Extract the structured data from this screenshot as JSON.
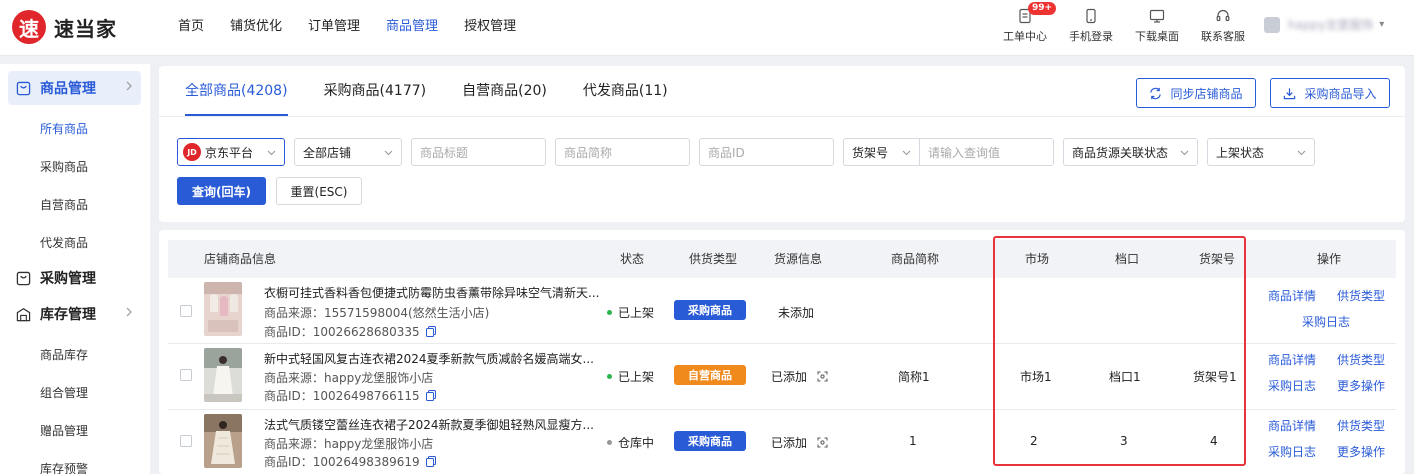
{
  "app": {
    "logo_char": "速",
    "name": "速当家"
  },
  "top_nav": [
    {
      "label": "首页"
    },
    {
      "label": "铺货优化"
    },
    {
      "label": "订单管理"
    },
    {
      "label": "商品管理",
      "active": true
    },
    {
      "label": "授权管理"
    }
  ],
  "tools": [
    {
      "label": "工单中心",
      "icon": "ticket-icon",
      "badge": "99+"
    },
    {
      "label": "手机登录",
      "icon": "mobile-icon"
    },
    {
      "label": "下载桌面",
      "icon": "desktop-icon"
    },
    {
      "label": "联系客服",
      "icon": "headset-icon"
    }
  ],
  "user": {
    "name": "happy龙堡服饰"
  },
  "sidebar": {
    "groups": [
      {
        "label": "商品管理",
        "icon": "product-icon",
        "active": true,
        "items": [
          {
            "label": "所有商品",
            "active": true
          },
          {
            "label": "采购商品"
          },
          {
            "label": "自营商品"
          },
          {
            "label": "代发商品"
          }
        ]
      },
      {
        "label": "采购管理",
        "icon": "purchase-icon"
      },
      {
        "label": "库存管理",
        "icon": "warehouse-icon",
        "items": [
          {
            "label": "商品库存"
          },
          {
            "label": "组合管理"
          },
          {
            "label": "赠品管理"
          },
          {
            "label": "库存预警"
          }
        ]
      }
    ]
  },
  "tabs": [
    {
      "label": "全部商品(4208)",
      "active": true
    },
    {
      "label": "采购商品(4177)"
    },
    {
      "label": "自营商品(20)"
    },
    {
      "label": "代发商品(11)"
    }
  ],
  "actions": {
    "sync_label": "同步店铺商品",
    "import_label": "采购商品导入"
  },
  "filters": {
    "platform": {
      "logo": "JD",
      "value": "京东平台"
    },
    "shop": {
      "value": "全部店铺"
    },
    "title_placeholder": "商品标题",
    "short_name_placeholder": "商品简称",
    "id_placeholder": "商品ID",
    "field_select": "货架号",
    "query_placeholder": "请输入查询值",
    "source_status": "商品货源关联状态",
    "listing_status": "上架状态",
    "search_label": "查询(回车)",
    "reset_label": "重置(ESC)"
  },
  "table": {
    "headers": {
      "product_info": "店铺商品信息",
      "status": "状态",
      "supply_type": "供货类型",
      "source_info": "货源信息",
      "short_name": "商品简称",
      "market": "市场",
      "stall": "档口",
      "shelf": "货架号",
      "actions": "操作"
    },
    "rows": [
      {
        "title": "衣橱可挂式香料香包便捷式防霉防虫香薰带除异味空气清新天...",
        "source": "商品来源：15571598004(悠然生活小店)",
        "id": "商品ID：10026628680335",
        "status": "已上架",
        "status_color": "#2bb24c",
        "supply_type": "采购商品",
        "supply_color": "#2a5bd7",
        "source_info": "未添加",
        "short_name": "",
        "market": "",
        "stall": "",
        "shelf": "",
        "links": [
          "商品详情",
          "供货类型",
          "采购日志"
        ]
      },
      {
        "title": "新中式轻国风复古连衣裙2024夏季新款气质减龄名媛高端女...",
        "source": "商品来源：happy龙堡服饰小店",
        "id": "商品ID：10026498766115",
        "status": "已上架",
        "status_color": "#2bb24c",
        "supply_type": "自营商品",
        "supply_color": "#f08a1c",
        "source_info": "已添加",
        "short_name": "简称1",
        "market": "市场1",
        "stall": "档口1",
        "shelf": "货架号1",
        "links": [
          "商品详情",
          "供货类型",
          "采购日志",
          "更多操作"
        ]
      },
      {
        "title": "法式气质镂空蕾丝连衣裙子2024新款夏季御姐轻熟风显瘦方...",
        "source": "商品来源：happy龙堡服饰小店",
        "id": "商品ID：10026498389619",
        "status": "仓库中",
        "status_color": "#999999",
        "supply_type": "采购商品",
        "supply_color": "#2a5bd7",
        "source_info": "已添加",
        "short_name": "1",
        "market": "2",
        "stall": "3",
        "shelf": "4",
        "links": [
          "商品详情",
          "供货类型",
          "采购日志",
          "更多操作"
        ]
      }
    ]
  },
  "colors": {
    "accent": "#2a5bd7",
    "brand": "#e0252b",
    "highlight": "#e8323c"
  }
}
